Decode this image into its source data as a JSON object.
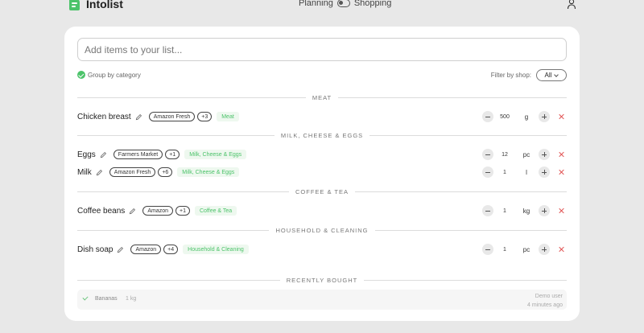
{
  "header": {
    "app_name": "Intolist",
    "mode_left": "Planning",
    "mode_right": "Shopping"
  },
  "search": {
    "placeholder": "Add items to your list..."
  },
  "controls": {
    "group_label": "Group by category",
    "filter_label": "Filter by shop:",
    "filter_value": "All"
  },
  "sections": [
    {
      "label": "MEAT"
    },
    {
      "label": "MILK, CHEESE & EGGS"
    },
    {
      "label": "COFFEE & TEA"
    },
    {
      "label": "HOUSEHOLD & CLEANING"
    }
  ],
  "items": [
    {
      "name": "Chicken breast",
      "shop": "Amazon Fresh",
      "more": "+3",
      "category": "Meat",
      "qty": "500",
      "unit": "g"
    },
    {
      "name": "Eggs",
      "shop": "Farmers Market",
      "more": "+1",
      "category": "Milk, Cheese & Eggs",
      "qty": "12",
      "unit": "pc"
    },
    {
      "name": "Milk",
      "shop": "Amazon Fresh",
      "more": "+6",
      "category": "Milk, Cheese & Eggs",
      "qty": "1",
      "unit": "l"
    },
    {
      "name": "Coffee beans",
      "shop": "Amazon",
      "more": "+1",
      "category": "Coffee & Tea",
      "qty": "1",
      "unit": "kg"
    },
    {
      "name": "Dish soap",
      "shop": "Amazon",
      "more": "+4",
      "category": "Household & Cleaning",
      "qty": "1",
      "unit": "pc"
    }
  ],
  "recent": {
    "label": "RECENTLY BOUGHT",
    "items": [
      {
        "name": "Bananas",
        "qty": "1 kg",
        "user": "Demo user",
        "time": "4 minutes ago"
      }
    ]
  },
  "colors": {
    "accent": "#4cc36a",
    "remove": "#e05050"
  }
}
